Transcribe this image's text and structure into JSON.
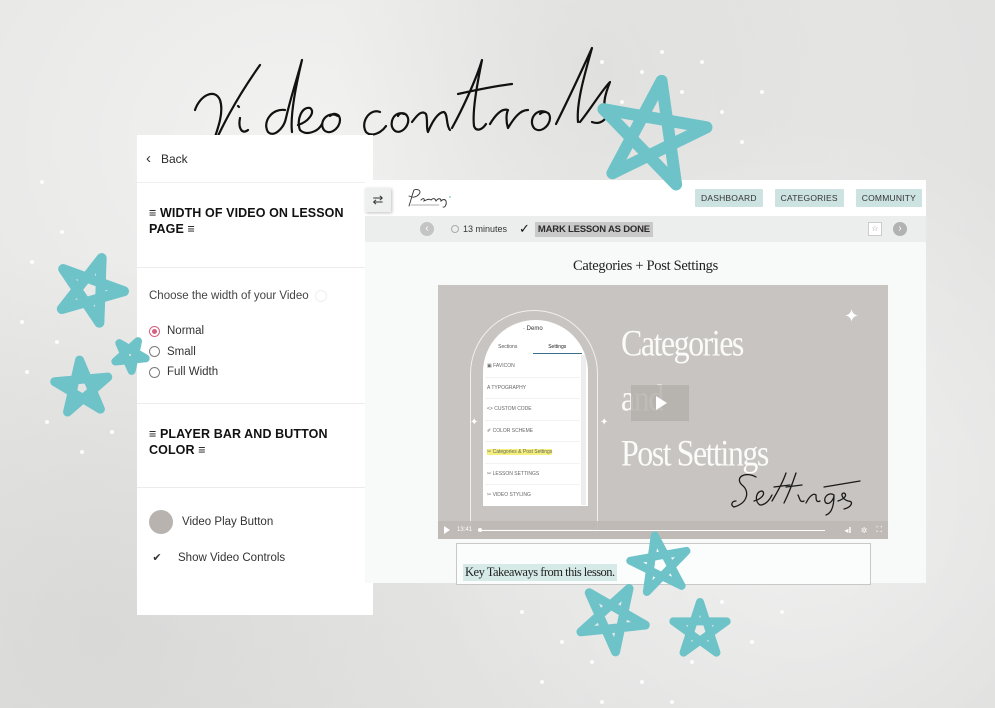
{
  "page": {
    "title": "Video controls",
    "accent_color": "#6ec3c8",
    "background_color": "#e6e6e5"
  },
  "settings_panel": {
    "back_label": "Back",
    "sections": [
      {
        "heading": "≡ WIDTH OF VIDEO ON LESSON PAGE ≡"
      },
      {
        "label": "Choose the width of your Video",
        "options": [
          {
            "label": "Normal",
            "selected": true
          },
          {
            "label": "Small",
            "selected": false
          },
          {
            "label": "Full Width",
            "selected": false
          }
        ],
        "selected_color": "#d6607f"
      },
      {
        "heading": "≡ PLAYER BAR AND BUTTON COLOR ≡"
      },
      {
        "color_label": "Video Play Button",
        "color_value": "#b8b3ae",
        "checkbox_label": "Show Video Controls",
        "checkbox_checked": true
      }
    ]
  },
  "preview": {
    "logo_text": "Penny",
    "nav": [
      "DASHBOARD",
      "CATEGORIES",
      "COMMUNITY"
    ],
    "nav_color": "#cde3e2",
    "lesson_bar": {
      "duration": "13 minutes",
      "mark_done_label": "MARK LESSON AS DONE"
    },
    "lesson_title": "Categories + Post Settings",
    "video": {
      "overlay_title_lines": [
        "Categories",
        "and",
        "Post Settings"
      ],
      "script_text": "Settings",
      "current_time": "13:41",
      "progress": 0,
      "phone_app_title": "· Demo",
      "phone_tabs": [
        "Sections",
        "Settings"
      ],
      "phone_active_tab": "Settings",
      "phone_menu": [
        "▣ FAVICON",
        "A TYPOGRAPHY",
        "<> CUSTOM CODE",
        "✐ COLOR SCHEME",
        "✂ Categories & Post Settings",
        "✂ LESSON SETTINGS",
        "✂ VIDEO STYLING"
      ],
      "phone_highlighted_index": 4
    },
    "takeaways_text": "Key Takeaways from this lesson."
  }
}
